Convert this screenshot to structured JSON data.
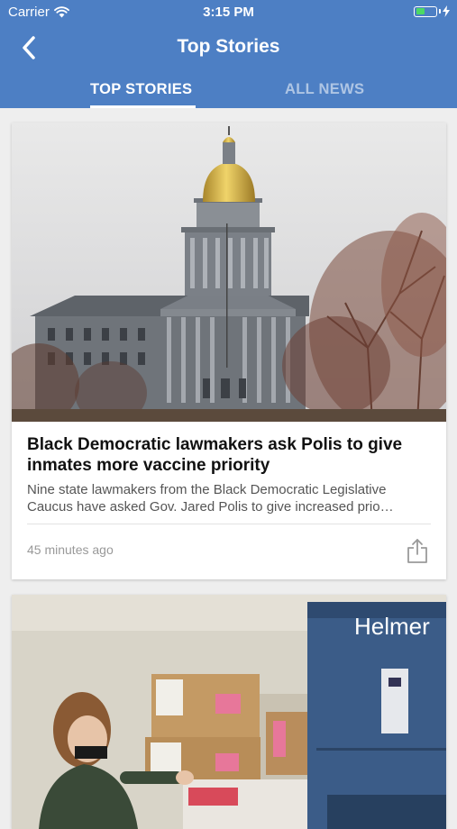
{
  "status_bar": {
    "carrier": "Carrier",
    "time": "3:15 PM"
  },
  "nav": {
    "title": "Top Stories",
    "tabs": [
      {
        "label": "TOP STORIES",
        "active": true
      },
      {
        "label": "ALL NEWS",
        "active": false
      }
    ]
  },
  "articles": [
    {
      "headline": "Black Democratic lawmakers ask Polis to give inmates more vaccine priority",
      "summary": "Nine state lawmakers from the Black Democratic Legislative Caucus have asked Gov. Jared Polis to give increased prio…",
      "age": "45 minutes ago",
      "share_icon": "share-icon"
    },
    {
      "image_sign": "Helmer"
    }
  ],
  "colors": {
    "header": "#4d7fc4",
    "battery": "#4cd964",
    "background": "#eeeeee"
  }
}
